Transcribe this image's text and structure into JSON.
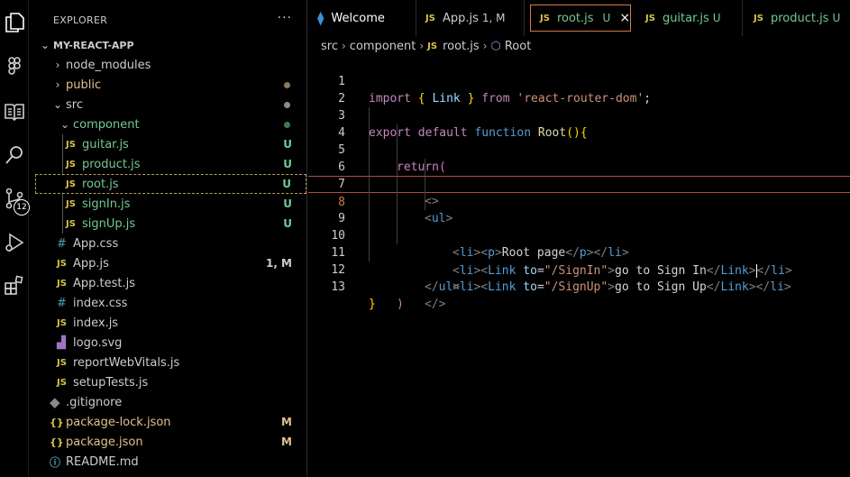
{
  "activity_bar": {
    "icons": [
      "explorer-icon",
      "figma-icon",
      "reader-icon",
      "search-icon",
      "source-control-icon",
      "run-debug-icon",
      "extensions-icon"
    ],
    "source_control_badge": "12"
  },
  "sidebar": {
    "header": "EXPLORER",
    "more": "···",
    "project": "MY-REACT-APP",
    "items": [
      {
        "label": "node_modules",
        "type": "folder",
        "status": ""
      },
      {
        "label": "public",
        "type": "folder",
        "status": ""
      },
      {
        "label": "src",
        "type": "folder",
        "status": ""
      },
      {
        "label": "component",
        "type": "folder",
        "status": ""
      },
      {
        "label": "guitar.js",
        "type": "js",
        "status": "U"
      },
      {
        "label": "product.js",
        "type": "js",
        "status": "U"
      },
      {
        "label": "root.js",
        "type": "js",
        "status": "U"
      },
      {
        "label": "signIn.js",
        "type": "js",
        "status": "U"
      },
      {
        "label": "signUp.js",
        "type": "js",
        "status": "U"
      },
      {
        "label": "App.css",
        "type": "css",
        "status": ""
      },
      {
        "label": "App.js",
        "type": "js",
        "status": "1, M"
      },
      {
        "label": "App.test.js",
        "type": "js",
        "status": ""
      },
      {
        "label": "index.css",
        "type": "css",
        "status": ""
      },
      {
        "label": "index.js",
        "type": "js",
        "status": ""
      },
      {
        "label": "logo.svg",
        "type": "svg",
        "status": ""
      },
      {
        "label": "reportWebVitals.js",
        "type": "js",
        "status": ""
      },
      {
        "label": "setupTests.js",
        "type": "js",
        "status": ""
      },
      {
        "label": ".gitignore",
        "type": "git",
        "status": ""
      },
      {
        "label": "package-lock.json",
        "type": "json",
        "status": "M"
      },
      {
        "label": "package.json",
        "type": "json",
        "status": "M"
      },
      {
        "label": "README.md",
        "type": "info",
        "status": ""
      }
    ],
    "icon_glyphs": {
      "js": "JS",
      "css": "#",
      "json": "{}"
    }
  },
  "tabs": [
    {
      "label": "Welcome",
      "status": ""
    },
    {
      "label": "App.js",
      "status": "1, M"
    },
    {
      "label": "root.js",
      "status": "U",
      "close": "×"
    },
    {
      "label": "guitar.js",
      "status": "U"
    },
    {
      "label": "product.js",
      "status": "U"
    }
  ],
  "breadcrumb": {
    "parts": [
      "src",
      "component",
      "root.js",
      "Root"
    ]
  },
  "editor": {
    "line_numbers": [
      "1",
      "2",
      "3",
      "4",
      "5",
      "6",
      "7",
      "8",
      "9",
      "10",
      "11",
      "12",
      "13"
    ],
    "active_line": "8",
    "lines": [
      "import { Link } from 'react-router-dom';",
      "",
      "export default function Root(){",
      "return(",
      "<>",
      "<ul>",
      "<li><p>Root page</p></li>",
      "<li><Link to=\"/SignIn\">go to Sign In</Link></li>",
      "<li><Link to=\"/SignUp\">go to Sign Up</Link></li>",
      "</ul>",
      "</>",
      ")",
      "}"
    ]
  },
  "colors": {
    "background": "#000000",
    "status_untracked": "#73c991",
    "status_modified": "#e2c08d",
    "folder_label": "#73c991",
    "modified_label": "#e2c08d",
    "active_tab_border": "#d37a4a",
    "current_line_border": "#b44a4a"
  }
}
